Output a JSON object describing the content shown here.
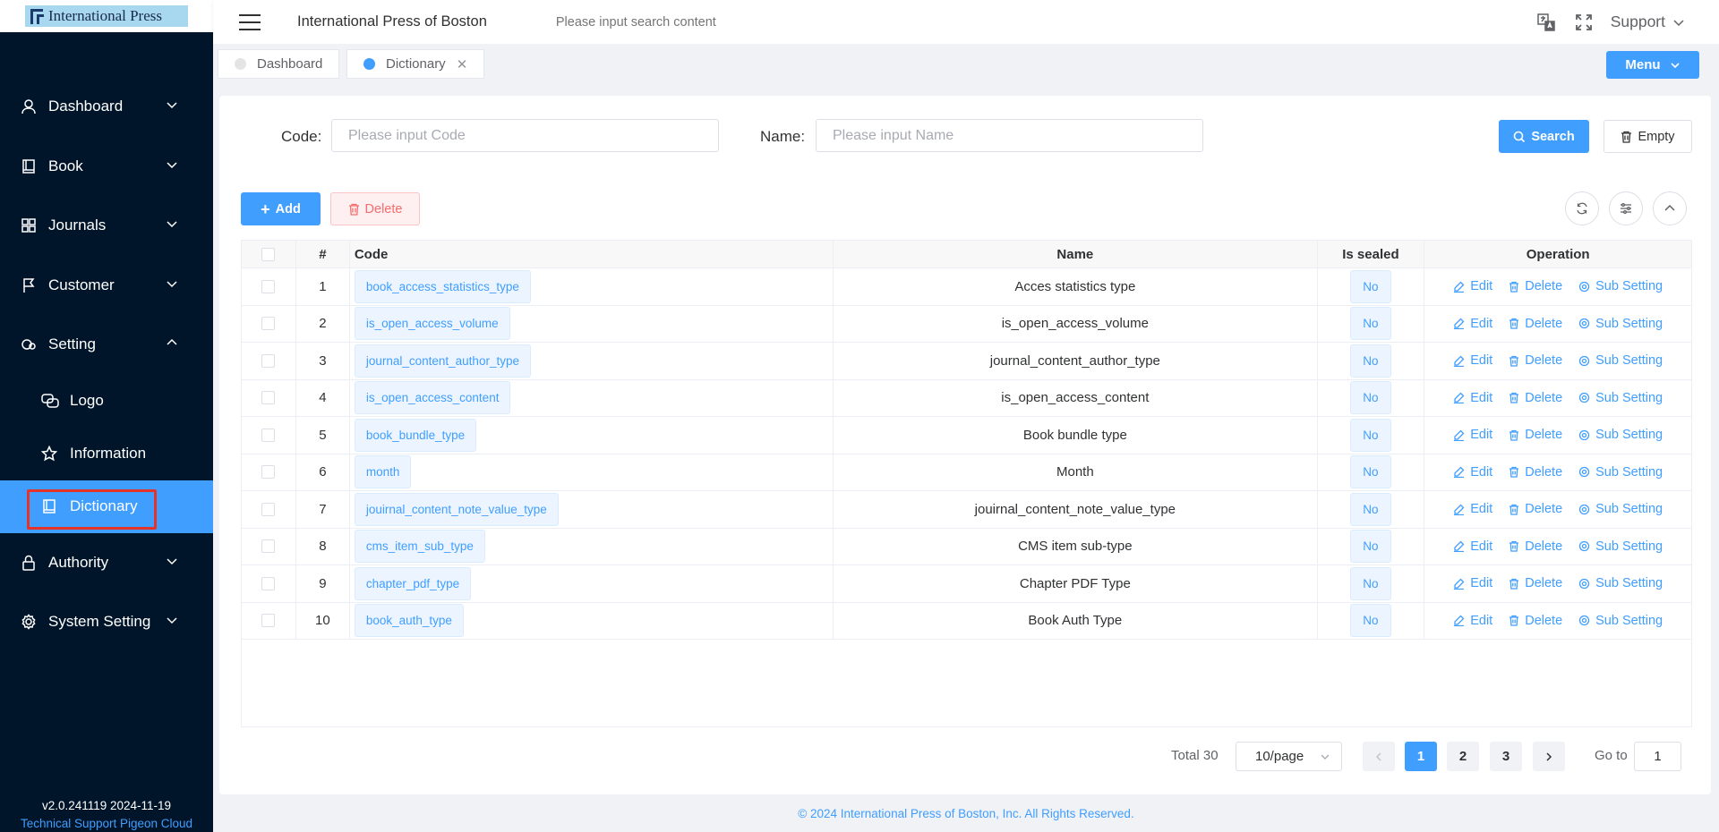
{
  "sidebar": {
    "logo_text": "International Press",
    "menu": [
      {
        "label": "Dashboard",
        "icon": "user-icon",
        "expanded": false
      },
      {
        "label": "Book",
        "icon": "book-icon",
        "expanded": false
      },
      {
        "label": "Journals",
        "icon": "grid-icon",
        "expanded": false
      },
      {
        "label": "Customer",
        "icon": "flag-icon",
        "expanded": false
      },
      {
        "label": "Setting",
        "icon": "setting-icon",
        "expanded": true
      }
    ],
    "submenu": [
      {
        "label": "Logo",
        "icon": "chat-icon"
      },
      {
        "label": "Information",
        "icon": "star-icon"
      },
      {
        "label": "Dictionary",
        "icon": "notebook-icon",
        "active": true
      }
    ],
    "menu_after": [
      {
        "label": "Authority",
        "icon": "lock-icon"
      },
      {
        "label": "System Setting",
        "icon": "gear-icon"
      }
    ],
    "version": "v2.0.241119 2024-11-19",
    "tech_support": "Technical Support Pigeon Cloud"
  },
  "header": {
    "title": "International Press of Boston",
    "search_placeholder": "Please input search content",
    "support_label": "Support"
  },
  "tabs": [
    {
      "label": "Dashboard",
      "active": false
    },
    {
      "label": "Dictionary",
      "active": true
    }
  ],
  "menu_button": "Menu",
  "filters": {
    "code_label": "Code:",
    "code_placeholder": "Please input Code",
    "name_label": "Name:",
    "name_placeholder": "Please input Name",
    "search_label": "Search",
    "empty_label": "Empty"
  },
  "toolbar": {
    "add_label": "Add",
    "delete_label": "Delete"
  },
  "table": {
    "columns": [
      "#",
      "Code",
      "Name",
      "Is sealed",
      "Operation"
    ],
    "op_edit": "Edit",
    "op_delete": "Delete",
    "op_sub": "Sub Setting",
    "rows": [
      {
        "num": "1",
        "code": "book_access_statistics_type",
        "name": "Acces statistics type",
        "sealed": "No"
      },
      {
        "num": "2",
        "code": "is_open_access_volume",
        "name": "is_open_access_volume",
        "sealed": "No"
      },
      {
        "num": "3",
        "code": "journal_content_author_type",
        "name": "journal_content_author_type",
        "sealed": "No"
      },
      {
        "num": "4",
        "code": "is_open_access_content",
        "name": "is_open_access_content",
        "sealed": "No"
      },
      {
        "num": "5",
        "code": "book_bundle_type",
        "name": "Book bundle type",
        "sealed": "No"
      },
      {
        "num": "6",
        "code": "month",
        "name": "Month",
        "sealed": "No"
      },
      {
        "num": "7",
        "code": "jouirnal_content_note_value_type",
        "name": "jouirnal_content_note_value_type",
        "sealed": "No"
      },
      {
        "num": "8",
        "code": "cms_item_sub_type",
        "name": "CMS item sub-type",
        "sealed": "No"
      },
      {
        "num": "9",
        "code": "chapter_pdf_type",
        "name": "Chapter PDF Type",
        "sealed": "No"
      },
      {
        "num": "10",
        "code": "book_auth_type",
        "name": "Book Auth Type",
        "sealed": "No"
      }
    ]
  },
  "pagination": {
    "total": "Total 30",
    "page_size": "10/page",
    "pages": [
      "1",
      "2",
      "3"
    ],
    "current": "1",
    "goto_label": "Go to",
    "goto_value": "1"
  },
  "footer": "© 2024 International Press of Boston, Inc. All Rights Reserved.",
  "colors": {
    "accent": "#409eff",
    "sidebar_bg": "#001529",
    "danger": "#f56c6c",
    "highlight_border": "#e5332a"
  }
}
